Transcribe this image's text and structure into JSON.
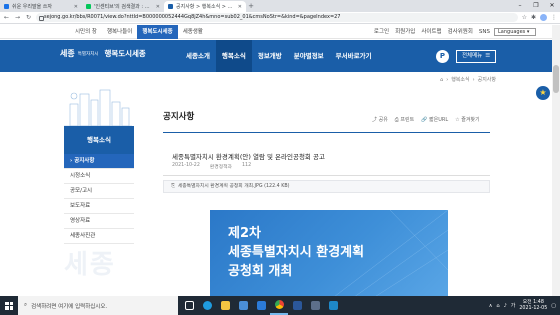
{
  "browser": {
    "tabs": [
      {
        "title": "쉬운 우리말을 쓰자",
        "color": "#1a73e8",
        "active": false
      },
      {
        "title": "'인센티브'의 검색결과 : 네이버",
        "color": "#03c75a",
        "active": false
      },
      {
        "title": "공지사항 > 행복소식 > 행복도",
        "color": "#1a5ea8",
        "active": true
      }
    ],
    "url": "sejong.go.kr/bbs/R0071/view.do?nttId=B000000052444Gq8jZ4h&mno=sub02_01&cmsNoStr=&kind=&pageIndex=27",
    "new_tab": "+",
    "controls": [
      "–",
      "❐",
      "✕"
    ]
  },
  "site_top": {
    "left_links": [
      "시민의 창",
      "행복나들이",
      "행복도시세종",
      "세종생활"
    ],
    "active_index": 2,
    "right_links": [
      "로그인",
      "회원가입",
      "사이트맵",
      "검사위원회",
      "SNS"
    ],
    "language": "Languages"
  },
  "header": {
    "logo_main": "세종",
    "logo_sub": "특별자치시",
    "logo_tag": "행복도시세종",
    "menu": [
      "세종소개",
      "행복소식",
      "정보개방",
      "분야별정보",
      "부서바로가기"
    ],
    "active_menu": 1,
    "search": "P",
    "all_menu": "전체메뉴"
  },
  "breadcrumb": [
    "⌂",
    "행복소식",
    "공지사항"
  ],
  "sidebar": {
    "title": "행복소식",
    "items": [
      "공지사항",
      "시정소식",
      "공모/고시",
      "보도자료",
      "영상자료",
      "세종사진관"
    ],
    "active_index": 0,
    "watermark": "세종"
  },
  "page": {
    "title": "공지사항",
    "tools": [
      "공유",
      "프린트",
      "짧은URL",
      "즐겨찾기"
    ]
  },
  "post": {
    "title": "세종특별자치시 환경계획(안) 열람 및 온라인공청회 공고",
    "date": "2021-10-22",
    "department": "환경정책과",
    "views": "112",
    "attachment": "세종특별자치시 환경계획 공청회 개최.JPG (122.4 KB)"
  },
  "poster": {
    "line1": "제2차",
    "line2": "세종특별자치시 환경계획",
    "line3": "공청회 개최"
  },
  "taskbar": {
    "search_placeholder": "검색하려면 여기에 입력하십시오.",
    "time": "오전 1:48",
    "date": "2021-12-05"
  }
}
